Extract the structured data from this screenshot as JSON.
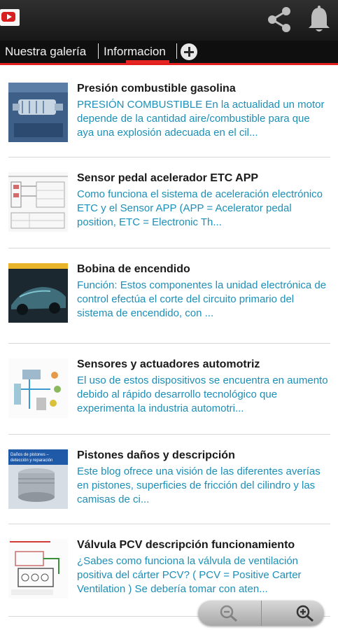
{
  "app": {
    "logo_icon": "youtube-icon",
    "actions": [
      "share-icon",
      "bell-icon"
    ]
  },
  "tabs": [
    {
      "label": "Nuestra galería",
      "active": false
    },
    {
      "label": "Informacion",
      "active": true
    }
  ],
  "add_tab_icon": "plus-circle-icon",
  "accent_color": "#e52521",
  "link_color": "#1c8fb8",
  "articles": [
    {
      "title": "Presión combustible gasolina",
      "description": "PRESIÓN COMBUSTIBLE En la actualidad un motor depende de la cantidad aire/combustible para que aya una explosión adecuada en el cil..."
    },
    {
      "title": "Sensor pedal acelerador ETC APP",
      "description": "Como funciona el sistema de aceleración electrónico ETC y el Sensor APP  (APP = Acelerator pedal position, ETC = Electronic Th..."
    },
    {
      "title": "Bobina de encendido",
      "description": "Función: Estos componentes la unidad electrónica de control efectúa el corte del circuito primario del sistema de encendido, con ..."
    },
    {
      "title": "Sensores y actuadores automotriz",
      "description": "El uso de estos dispositivos se encuentra en aumento debido al rápido desarrollo tecnológico que experimenta la industria automotri..."
    },
    {
      "title": "Pistones daños y descripción",
      "description": "Este blog ofrece una visión de las diferentes averías en pistones, superficies de fricción del cilindro y las camisas de ci...",
      "thumb_caption": "Daños de pistones – detección y reparación"
    },
    {
      "title": "Válvula PCV descripción funcionamiento",
      "description": "¿Sabes como funciona la válvula de ventilación positiva del cárter PCV? ( PCV = Positive Carter Ventilation ) Se debería tomar con aten..."
    }
  ],
  "zoom_controls": [
    "zoom-out-icon",
    "zoom-in-icon"
  ]
}
